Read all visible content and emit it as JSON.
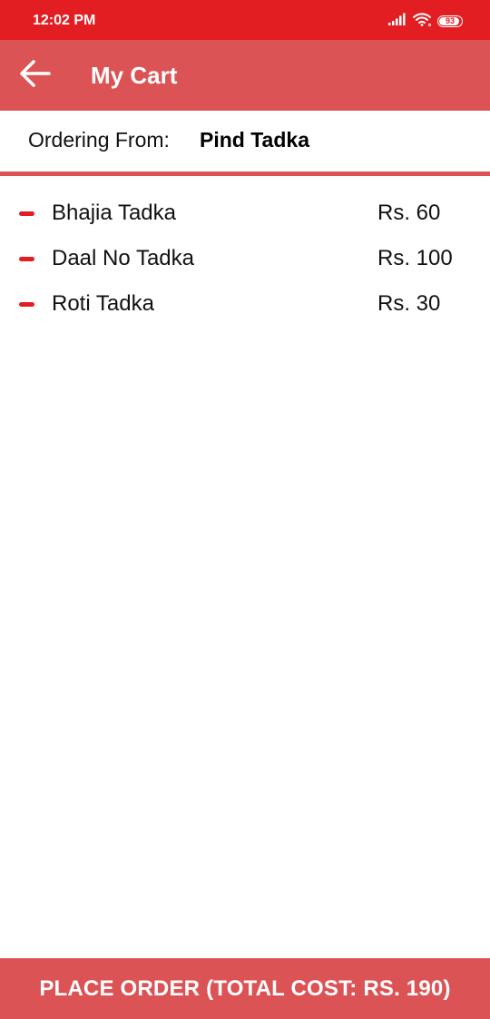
{
  "status_bar": {
    "time": "12:02 PM",
    "battery_level": "93",
    "icons": [
      "signal-icon",
      "wifi-icon",
      "battery-icon"
    ]
  },
  "app_bar": {
    "back_icon": "arrow-left-icon",
    "title": "My Cart"
  },
  "ordering": {
    "label": "Ordering From:",
    "restaurant": "Pind Tadka"
  },
  "cart": {
    "remove_icon": "minus-icon",
    "items": [
      {
        "name": "Bhajia Tadka",
        "price": "Rs. 60"
      },
      {
        "name": "Daal No Tadka",
        "price": "Rs. 100"
      },
      {
        "name": "Roti Tadka",
        "price": "Rs. 30"
      }
    ]
  },
  "footer": {
    "place_order_label": "PLACE ORDER (TOTAL COST: RS. 190)"
  },
  "colors": {
    "status_bar": "#e21e22",
    "primary": "#dc5355",
    "remove_icon": "#e21e22"
  }
}
